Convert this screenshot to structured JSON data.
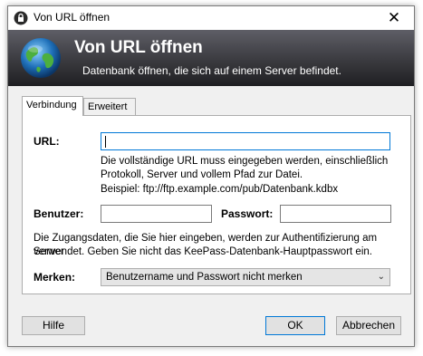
{
  "window": {
    "title": "Von URL öffnen",
    "close_symbol": "✕"
  },
  "banner": {
    "title": "Von URL öffnen",
    "subtitle": "Datenbank öffnen, die sich auf einem Server befindet."
  },
  "tabs": [
    {
      "label": "Verbindung",
      "active": true
    },
    {
      "label": "Erweitert",
      "active": false
    }
  ],
  "url": {
    "label": "URL:",
    "value": "",
    "help_line1": "Die vollständige URL muss eingegeben werden, einschließlich",
    "help_line2": "Protokoll, Server und vollem Pfad zur Datei.",
    "example": "Beispiel: ftp://ftp.example.com/pub/Datenbank.kdbx"
  },
  "user": {
    "label": "Benutzer:",
    "value": ""
  },
  "password": {
    "label": "Passwort:",
    "value": ""
  },
  "info": {
    "line1": "Die Zugangsdaten, die Sie hier eingeben, werden zur Authentifizierung am Server",
    "line2": "verwendet. Geben Sie nicht das KeePass-Datenbank-Hauptpasswort ein."
  },
  "remember": {
    "label": "Merken:",
    "selected": "Benutzername und Passwort nicht merken"
  },
  "buttons": {
    "help": "Hilfe",
    "ok": "OK",
    "cancel": "Abbrechen"
  },
  "colors": {
    "accent": "#0078d7",
    "banner_top": "#5e5e66",
    "banner_bottom": "#1f1f22"
  }
}
